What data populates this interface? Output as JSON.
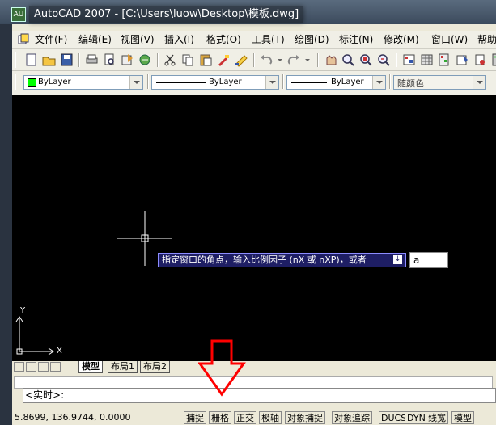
{
  "window": {
    "title": "AutoCAD 2007 - [C:\\Users\\luow\\Desktop\\模板.dwg]",
    "app_icon_text": "AU"
  },
  "menu": {
    "items": [
      "文件(F)",
      "编辑(E)",
      "视图(V)",
      "插入(I)",
      "格式(O)",
      "工具(T)",
      "绘图(D)",
      "标注(N)",
      "修改(M)",
      "窗口(W)",
      "帮助"
    ]
  },
  "toolbar": {
    "icons": [
      "new-icon",
      "open-icon",
      "save-icon",
      "print-icon",
      "print-preview-icon",
      "publish-icon",
      "cut-icon",
      "copy-icon",
      "paste-icon",
      "match-properties-icon",
      "block-editor-icon",
      "undo-icon",
      "redo-icon",
      "pan-icon",
      "zoom-realtime-icon",
      "zoom-window-icon",
      "zoom-previous-icon",
      "properties-icon",
      "design-center-icon",
      "tool-palettes-icon",
      "sheet-set-icon",
      "markup-icon",
      "calculator-icon"
    ]
  },
  "properties_bar": {
    "color_value": "ByLayer",
    "linetype_value": "ByLayer",
    "lineweight_value": "ByLayer",
    "plotstyle_value": "随颜色",
    "color_swatch": "#00ff00"
  },
  "canvas": {
    "background": "#000000",
    "tooltip_text": "指定窗口的角点，输入比例因子 (nX 或 nXP)，或者",
    "tooltip_icon": "↓",
    "input_value": "a",
    "ucs_x_label": "X",
    "ucs_y_label": "Y"
  },
  "tabs": {
    "items": [
      "模型",
      "布局1",
      "布局2"
    ],
    "active": "模型"
  },
  "command": {
    "prompt": "<实时>:"
  },
  "status": {
    "coords": "5.8699,  136.9744, 0.0000",
    "buttons": [
      "捕捉",
      "栅格",
      "正交",
      "极轴",
      "对象捕捉",
      "对象追踪",
      "DUCS",
      "DYN",
      "线宽",
      "模型"
    ]
  },
  "overlay": {
    "arrow_color": "#ff0000"
  }
}
